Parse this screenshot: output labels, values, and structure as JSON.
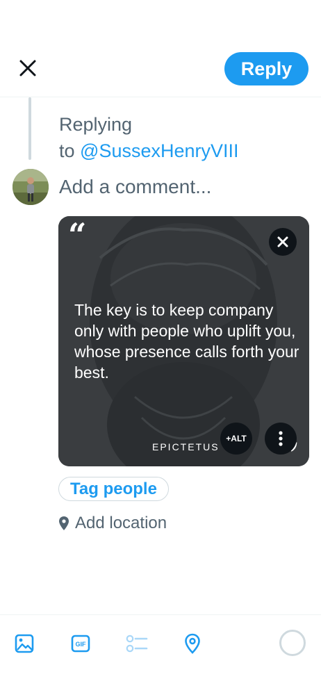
{
  "header": {
    "close_icon": "close-icon",
    "reply_label": "Reply"
  },
  "reply_context": {
    "prefix": "Replying",
    "to": "to",
    "handle": "@SussexHenryVIII"
  },
  "composer": {
    "placeholder": "Add a comment..."
  },
  "media": {
    "quote_text": "The key is to keep company only with people who uplift you, whose presence calls forth your best.",
    "author": "EPICTETUS",
    "open_quote": "“",
    "close_quote": "”",
    "alt_label": "+ALT",
    "remove_icon": "close-icon",
    "more_icon": "more-vertical-icon"
  },
  "tag_people_label": "Tag people",
  "location": {
    "label": "Add location",
    "icon": "location-pin-icon"
  },
  "toolbar": {
    "items": [
      "image-icon",
      "gif-icon",
      "poll-icon",
      "location-icon"
    ],
    "progress_icon": "character-count-ring"
  },
  "colors": {
    "accent": "#1d9bf0",
    "text_secondary": "#536471",
    "divider": "#eff3f4",
    "media_bg": "#3b3e41"
  }
}
